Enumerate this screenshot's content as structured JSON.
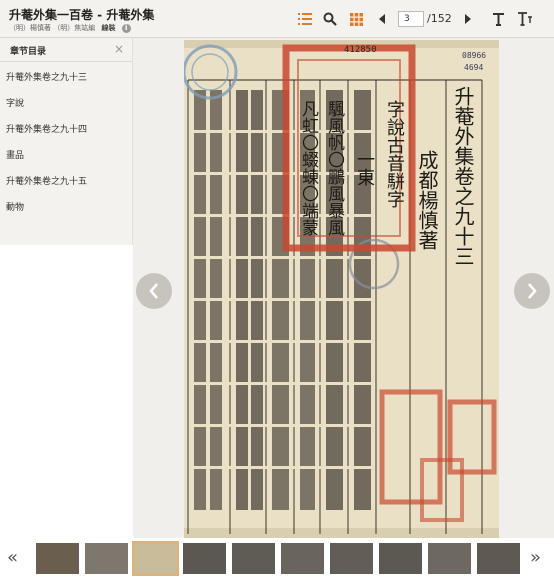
{
  "header": {
    "title": "升菴外集一百卷 - 升菴外集",
    "author1": "（明）楊慎著",
    "author2": "（明）焦竑編",
    "edition": "線裝"
  },
  "toolbar": {
    "icons": [
      "list-icon",
      "search-icon",
      "grid-icon",
      "prev-page-icon",
      "next-page-icon",
      "text-icon",
      "text-size-icon"
    ],
    "current_page": "3",
    "total_pages": "/152"
  },
  "sidebar": {
    "heading": "章节目录",
    "close": "×",
    "chapters": [
      "升菴外集卷之九十三",
      "字說",
      "升菴外集卷之九十四",
      "畫品",
      "升菴外集卷之九十五",
      "動物"
    ]
  },
  "scan": {
    "serial": "412850",
    "accession": "08966",
    "accession2": "4694",
    "columns": [
      "升菴外集卷之九十三",
      "成都楊慎著",
      "字說古音駢字",
      "一東",
      "颿風帆〇鵬風暴風",
      "凡虹〇蝃蝀〇端蒙"
    ],
    "colors": {
      "paper": "#e9e0c6",
      "ink": "#1e1a16",
      "seal_red": "#c9482f",
      "seal_blue": "#7f9cb8",
      "accent": "#e07a2b"
    }
  },
  "thumbnails": {
    "prev": "«",
    "next": "»",
    "active_index": 2,
    "count": 10
  }
}
